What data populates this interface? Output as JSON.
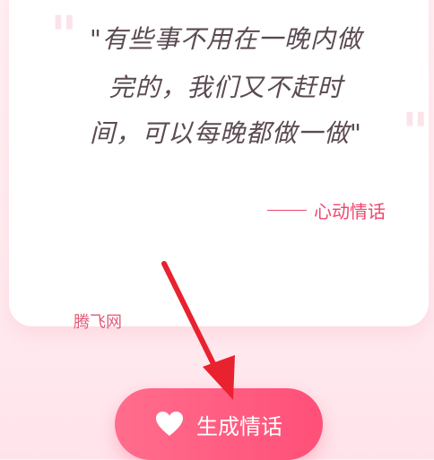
{
  "quote": {
    "lines": [
      "\"有些事不用在一晚内做",
      "完的，我们又不赶时",
      "间，可以每晚都做一做\""
    ],
    "open_mark": "\"",
    "close_mark": "\""
  },
  "attribution": {
    "source": "心动情话"
  },
  "watermark": {
    "text": "腾飞网"
  },
  "button": {
    "label": "生成情话",
    "icon": "heart-icon"
  },
  "colors": {
    "accent": "#f0466e",
    "button": "#ff5a7e",
    "arrow": "#e8222f",
    "text": "#5a4a52"
  }
}
